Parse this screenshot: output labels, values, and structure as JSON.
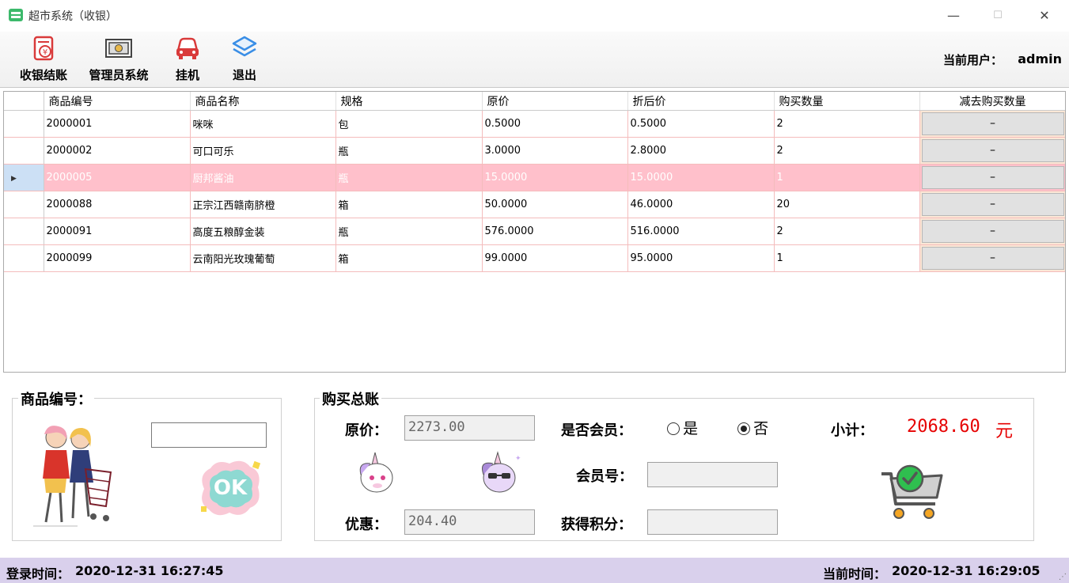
{
  "window": {
    "title": "超市系统（收银）",
    "min": "—",
    "max": "☐",
    "close": "✕"
  },
  "toolbar": {
    "checkout": "收银结账",
    "admin_system": "管理员系统",
    "hang_up": "挂机",
    "exit": "退出",
    "current_user_label": "当前用户：",
    "current_user": "admin"
  },
  "table": {
    "columns": [
      "商品编号",
      "商品名称",
      "规格",
      "原价",
      "折后价",
      "购买数量",
      "减去购买数量"
    ],
    "rows": [
      {
        "id": "2000001",
        "name": "咪咪",
        "spec": "包",
        "price": "0.5000",
        "discount_price": "0.5000",
        "qty": "2",
        "btn": "–"
      },
      {
        "id": "2000002",
        "name": "可口可乐",
        "spec": "瓶",
        "price": "3.0000",
        "discount_price": "2.8000",
        "qty": "2",
        "btn": "–"
      },
      {
        "id": "2000005",
        "name": "厨邦酱油",
        "spec": "瓶",
        "price": "15.0000",
        "discount_price": "15.0000",
        "qty": "1",
        "btn": "–"
      },
      {
        "id": "2000088",
        "name": "正宗江西赣南脐橙",
        "spec": "箱",
        "price": "50.0000",
        "discount_price": "46.0000",
        "qty": "20",
        "btn": "–"
      },
      {
        "id": "2000091",
        "name": "高度五粮醇金装",
        "spec": "瓶",
        "price": "576.0000",
        "discount_price": "516.0000",
        "qty": "2",
        "btn": "–"
      },
      {
        "id": "2000099",
        "name": "云南阳光玫瑰葡萄",
        "spec": "箱",
        "price": "99.0000",
        "discount_price": "95.0000",
        "qty": "1",
        "btn": "–"
      }
    ],
    "selected_row": 2
  },
  "product_panel": {
    "title": "商品编号：",
    "input": "",
    "ok_label": "OK"
  },
  "summary": {
    "title": "购买总账",
    "original_label": "原价：",
    "original_value": "2273.00",
    "member_q": "是否会员：",
    "yes": "是",
    "no": "否",
    "member_selected": "否",
    "subtotal_label": "小计：",
    "subtotal_value": "2068.60",
    "yuan": "元",
    "member_no_label": "会员号：",
    "member_no": "",
    "discount_label": "优惠：",
    "discount_value": "204.40",
    "points_label": "获得积分：",
    "points": ""
  },
  "status": {
    "login_label": "登录时间：",
    "login_time": "2020-12-31  16:27:45",
    "current_label": "当前时间：",
    "current_time": "2020-12-31  16:29:05"
  },
  "colors": {
    "selected_row": "#ffc0cb",
    "subtotal": "#e60000",
    "status_bar": "#d9d0ec"
  }
}
